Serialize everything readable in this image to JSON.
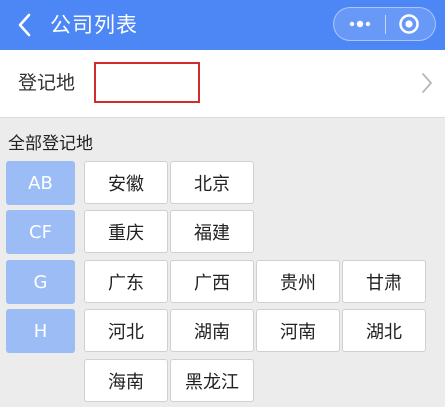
{
  "header": {
    "title": "公司列表",
    "back_icon": "chevron-left-icon",
    "more_icon": "more-dots-icon",
    "close_icon": "record-circle-icon"
  },
  "filter": {
    "label": "登记地",
    "value": "",
    "arrow_icon": "chevron-right-icon"
  },
  "section": {
    "title": "全部登记地"
  },
  "groups": [
    {
      "tag": "AB",
      "items": [
        "安徽",
        "北京"
      ]
    },
    {
      "tag": "CF",
      "items": [
        "重庆",
        "福建"
      ]
    },
    {
      "tag": "G",
      "items": [
        "广东",
        "广西",
        "贵州",
        "甘肃"
      ]
    },
    {
      "tag": "H",
      "items": [
        "河北",
        "湖南",
        "河南",
        "湖北",
        "海南",
        "黑龙江"
      ]
    }
  ],
  "colors": {
    "header_bg": "#4d86f5",
    "tag_bg": "#9bbcf5",
    "highlight_border": "#d22d2d"
  }
}
